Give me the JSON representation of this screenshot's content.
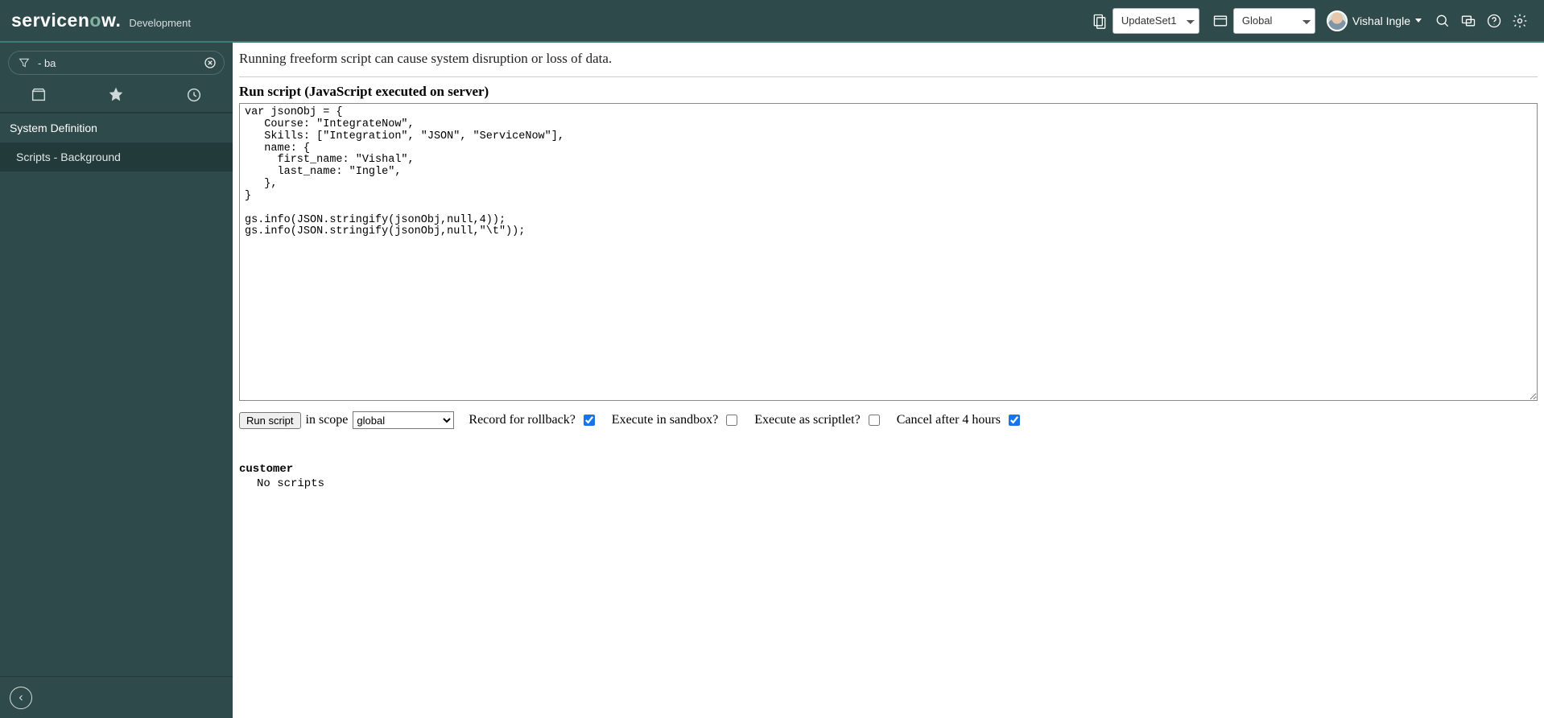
{
  "header": {
    "logo_prefix": "service",
    "logo_n": "n",
    "logo_o": "o",
    "logo_suffix": "w.",
    "environment": "Development",
    "update_set_selected": "UpdateSet1",
    "scope_selected": "Global",
    "user_name": "Vishal Ingle"
  },
  "sidebar": {
    "filter_value": "- ba",
    "section_header": "System Definition",
    "items": [
      {
        "label": "Scripts - Background"
      }
    ]
  },
  "main": {
    "warning": "Running freeform script can cause system disruption or loss of data.",
    "section_title": "Run script (JavaScript executed on server)",
    "script_text": "var jsonObj = {\n   Course: \"IntegrateNow\",\n   Skills: [\"Integration\", \"JSON\", \"ServiceNow\"],\n   name: {\n     first_name: \"Vishal\",\n     last_name: \"Ingle\",\n   },\n}\n\ngs.info(JSON.stringify(jsonObj,null,4));\ngs.info(JSON.stringify(jsonObj,null,\"\\t\"));",
    "run_button": "Run script",
    "in_scope_label": "in scope",
    "scope_options": [
      "global"
    ],
    "scope_selected": "global",
    "checkboxes": {
      "rollback_label": "Record for rollback?",
      "rollback_checked": true,
      "sandbox_label": "Execute in sandbox?",
      "sandbox_checked": false,
      "scriptlet_label": "Execute as scriptlet?",
      "scriptlet_checked": false,
      "cancel_label": "Cancel after 4 hours",
      "cancel_checked": true
    },
    "output_heading": "customer",
    "output_body": "No scripts"
  }
}
